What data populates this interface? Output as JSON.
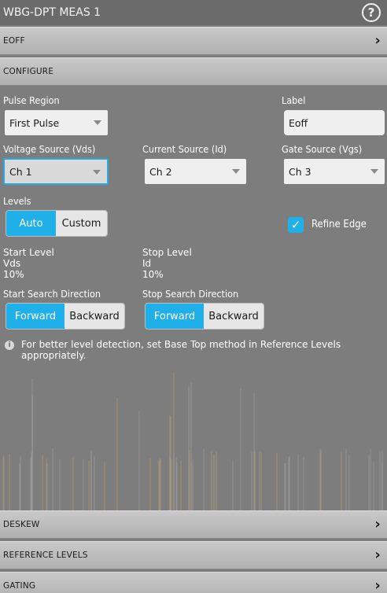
{
  "title": "WBG-DPT MEAS 1",
  "help_icon": "help-icon",
  "sections": {
    "eoff": "EOFF",
    "configure": "CONFIGURE",
    "deskew": "DESKEW",
    "reference_levels": "REFERENCE LEVELS",
    "gating": "GATING"
  },
  "pulse_region": {
    "label": "Pulse Region",
    "value": "First Pulse"
  },
  "label_field": {
    "label": "Label",
    "value": "Eoff"
  },
  "voltage_source": {
    "label": "Voltage Source (Vds)",
    "value": "Ch 1"
  },
  "current_source": {
    "label": "Current Source (Id)",
    "value": "Ch 2"
  },
  "gate_source": {
    "label": "Gate Source (Vgs)",
    "value": "Ch 3"
  },
  "levels": {
    "label": "Levels",
    "auto": "Auto",
    "custom": "Custom",
    "selected": "Auto"
  },
  "refine_edge": {
    "label": "Refine Edge",
    "checked": true
  },
  "start_level": {
    "label": "Start Level",
    "source": "Vds",
    "value": "10%"
  },
  "stop_level": {
    "label": "Stop Level",
    "source": "Id",
    "value": "10%"
  },
  "start_search": {
    "label": "Start Search Direction",
    "forward": "Forward",
    "backward": "Backward",
    "selected": "Forward"
  },
  "stop_search": {
    "label": "Stop Search Direction",
    "forward": "Forward",
    "backward": "Backward",
    "selected": "Forward"
  },
  "info_message": "For better level detection, set Base Top method in Reference Levels appropriately.",
  "colors": {
    "accent": "#1fb0ea",
    "panel": "#7d7d7d",
    "header": "#c0c0c0",
    "trace": "#c8a060"
  }
}
